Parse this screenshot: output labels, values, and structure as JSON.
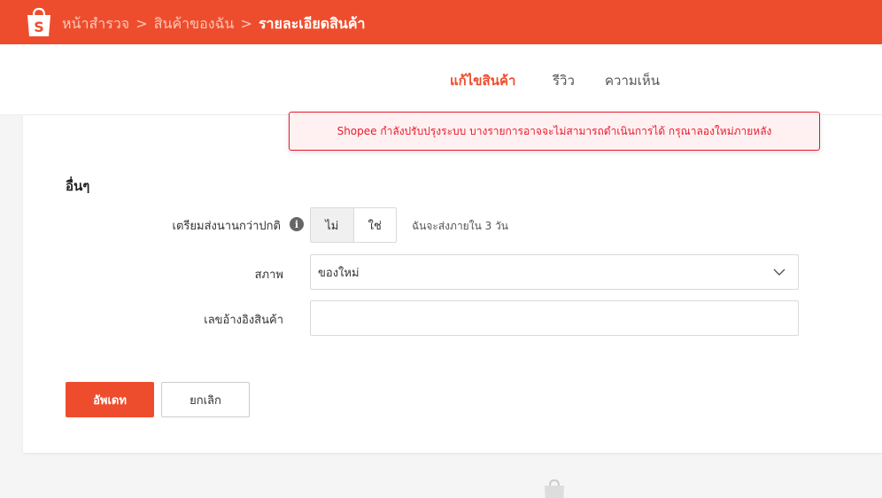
{
  "header": {
    "breadcrumbs": [
      {
        "label": "หน้าสำรวจ"
      },
      {
        "label": "สินค้าของฉัน"
      },
      {
        "label": "รายละเอียดสินค้า"
      }
    ],
    "separator": ">",
    "logo_letter": "S"
  },
  "tabs": [
    {
      "label": "แก้ไขสินค้า",
      "active": true
    },
    {
      "label": "รีวิว",
      "active": false
    },
    {
      "label": "ความเห็น",
      "active": false
    }
  ],
  "alert": {
    "message": "Shopee กำลังปรับปรุงระบบ บางรายการอาจจะไม่สามารถดำเนินการได้ กรุณาลองใหม่ภายหลัง"
  },
  "section": {
    "title": "อื่นๆ"
  },
  "form": {
    "preorder_label": "เตรียมส่งนานกว่าปกติ",
    "preorder_info_icon": "i",
    "preorder_options": [
      "ไม่",
      "ใช่"
    ],
    "preorder_selected": "ไม่",
    "preorder_hint": "ฉันจะส่งภายใน 3 วัน",
    "condition_label": "สภาพ",
    "condition_value": "ของใหม่",
    "sku_label": "เลขอ้างอิงสินค้า",
    "sku_value": "",
    "sku_placeholder": ""
  },
  "actions": {
    "update_label": "อัพเดท",
    "cancel_label": "ยกเลิก"
  },
  "colors": {
    "brand": "#ee4d2d",
    "alert": "#e8192c"
  },
  "icons": {
    "logo": "shopee-bag-icon",
    "info": "info-icon",
    "chevron": "chevron-down-icon"
  }
}
